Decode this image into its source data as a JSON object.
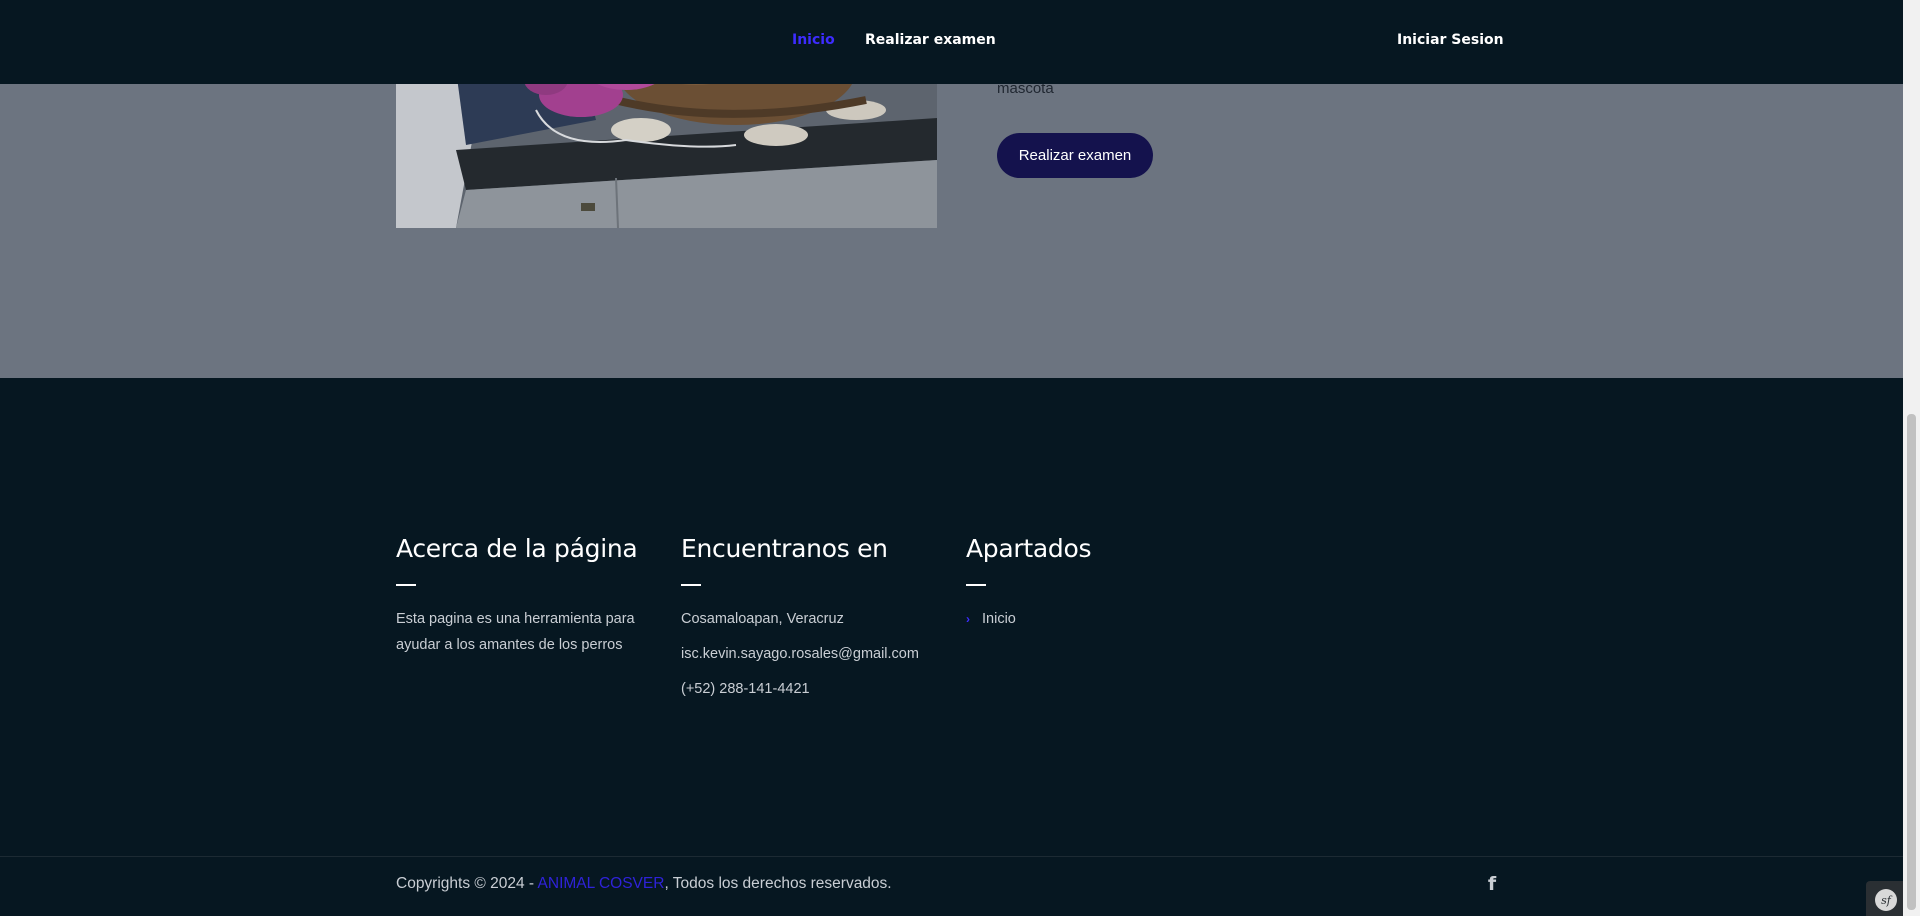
{
  "nav": {
    "links": [
      {
        "label": "Inicio",
        "active": true
      },
      {
        "label": "Realizar examen",
        "active": false
      }
    ],
    "login_label": "Iniciar Sesion"
  },
  "hero": {
    "text_fragment": "mascota",
    "cta_label": "Realizar examen"
  },
  "footer": {
    "about": {
      "title": "Acerca de la página",
      "text": "Esta pagina es una herramienta para ayudar a los amantes de los perros"
    },
    "contact": {
      "title": "Encuentranos en",
      "location": "Cosamaloapan, Veracruz",
      "email": "isc.kevin.sayago.rosales@gmail.com",
      "phone": "(+52) 288-141-4421"
    },
    "sections": {
      "title": "Apartados",
      "items": [
        "Inicio"
      ]
    },
    "copyright": {
      "prefix": "Copyrights © 2024 - ",
      "brand": "ANIMAL COSVER",
      "suffix": ", Todos los derechos reservados."
    },
    "social_icon": "facebook-icon"
  },
  "colors": {
    "nav_bg": "#061721",
    "active_link": "#3d2cff",
    "cta_bg": "#14124d",
    "hero_overlay": "#6c7480"
  }
}
